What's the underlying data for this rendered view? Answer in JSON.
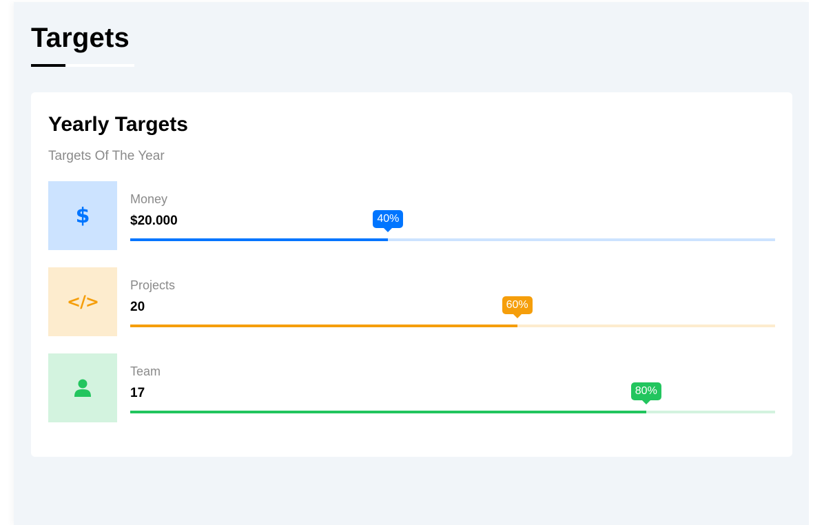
{
  "page": {
    "title": "Targets"
  },
  "card": {
    "title": "Yearly Targets",
    "subtitle": "Targets Of The Year"
  },
  "targets": [
    {
      "icon": "dollar-icon",
      "label": "Money",
      "value": "$20.000",
      "progress": 40,
      "progress_label": "40%",
      "color": "#0075ff",
      "light": "#cce3ff"
    },
    {
      "icon": "code-icon",
      "label": "Projects",
      "value": "20",
      "progress": 60,
      "progress_label": "60%",
      "color": "#f59e0b",
      "light": "#fdecce"
    },
    {
      "icon": "user-icon",
      "label": "Team",
      "value": "17",
      "progress": 80,
      "progress_label": "80%",
      "color": "#22c55e",
      "light": "#d3f3df"
    }
  ]
}
